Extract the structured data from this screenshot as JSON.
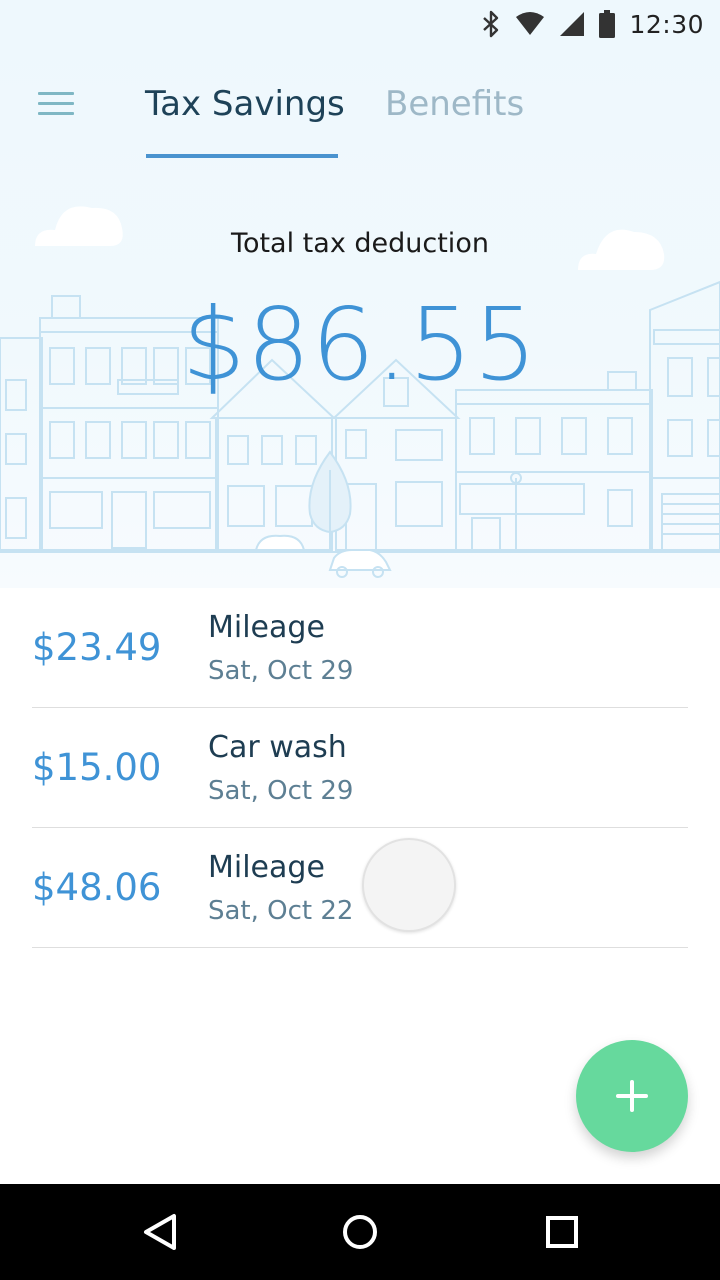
{
  "status_bar": {
    "time": "12:30",
    "icons": [
      "bluetooth-icon",
      "wifi-icon",
      "signal-icon",
      "battery-icon"
    ]
  },
  "toolbar": {
    "menu_icon": "hamburger-menu-icon",
    "tabs": [
      {
        "label": "Tax Savings",
        "active": true
      },
      {
        "label": "Benefits",
        "active": false
      }
    ]
  },
  "summary": {
    "label": "Total tax deduction",
    "amount": "$86.55"
  },
  "entries": [
    {
      "amount": "$23.49",
      "title": "Mileage",
      "date": "Sat, Oct 29"
    },
    {
      "amount": "$15.00",
      "title": "Car wash",
      "date": "Sat, Oct 29"
    },
    {
      "amount": "$48.06",
      "title": "Mileage",
      "date": "Sat, Oct 22"
    }
  ],
  "fab": {
    "icon": "plus-icon",
    "color": "#66d99d"
  },
  "nav_bar": {
    "buttons": [
      "back-icon",
      "home-icon",
      "recents-icon"
    ]
  },
  "colors": {
    "accent": "#3f93d6",
    "tab_active": "#1e4258",
    "tab_inactive": "#9eb8c7",
    "header_bg": "#eef8fd"
  }
}
